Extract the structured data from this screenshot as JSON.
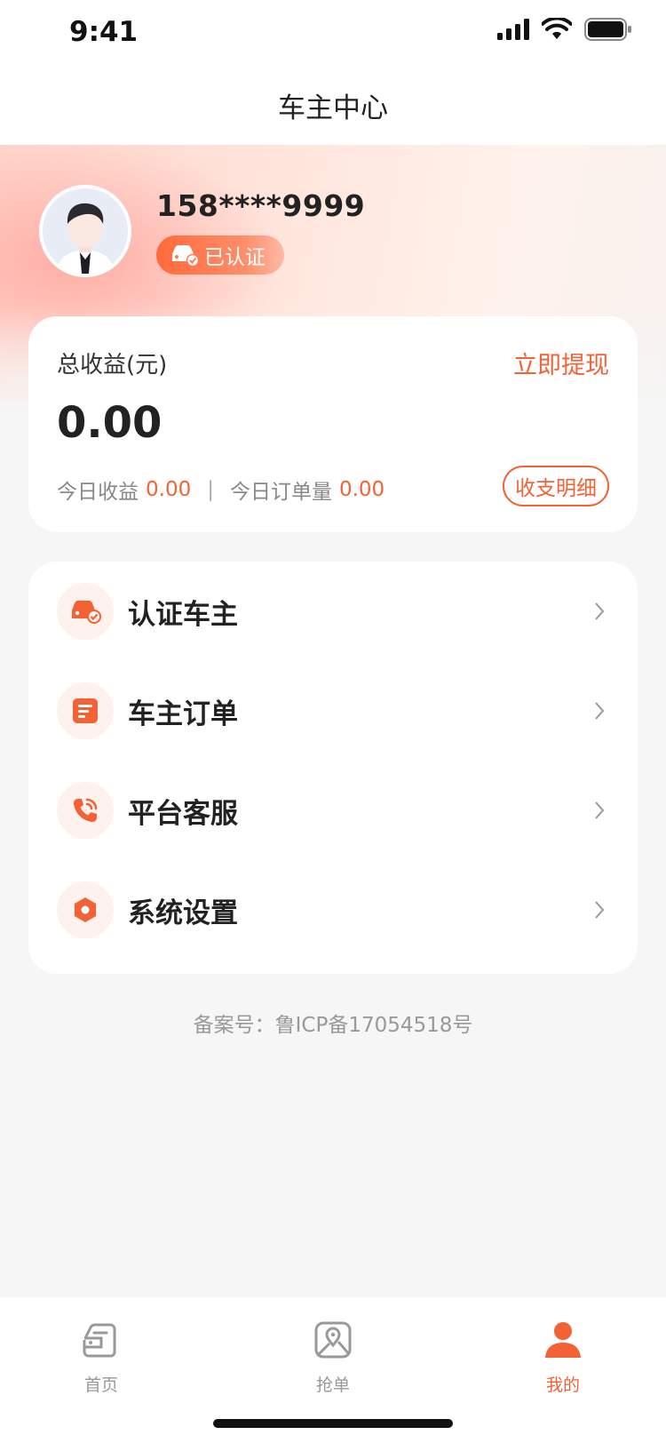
{
  "status_bar": {
    "time": "9:41"
  },
  "header": {
    "title": "车主中心"
  },
  "profile": {
    "phone": "158****9999",
    "badge": "已认证"
  },
  "earnings": {
    "label": "总收益(元)",
    "withdraw_label": "立即提现",
    "total": "0.00",
    "today_income_label": "今日收益",
    "today_income": "0.00",
    "separator": "|",
    "today_orders_label": "今日订单量",
    "today_orders": "0.00",
    "detail_button": "收支明细"
  },
  "menu": {
    "items": [
      {
        "label": "认证车主",
        "icon": "car-verified-icon"
      },
      {
        "label": "车主订单",
        "icon": "order-list-icon"
      },
      {
        "label": "平台客服",
        "icon": "phone-service-icon"
      },
      {
        "label": "系统设置",
        "icon": "settings-hex-icon"
      }
    ]
  },
  "footer": {
    "icp": "备案号：鲁ICP备17054518号"
  },
  "tabs": [
    {
      "label": "首页",
      "icon": "home-car-icon",
      "active": false
    },
    {
      "label": "抢单",
      "icon": "map-pin-icon",
      "active": false
    },
    {
      "label": "我的",
      "icon": "user-icon",
      "active": true
    }
  ],
  "colors": {
    "accent": "#f26234",
    "text": "#222222",
    "muted": "#999999"
  }
}
